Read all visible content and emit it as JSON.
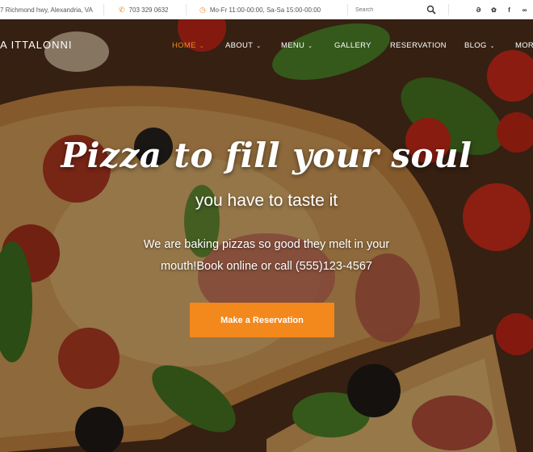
{
  "topbar": {
    "address": "7 Richmond hwy, Alexandria, VA",
    "phone": "703 329 0632",
    "hours": "Mo-Fr 11:00-00:00, Sa-Sa 15:00-00:00",
    "search_placeholder": "Search",
    "social": [
      "foursquare-icon",
      "twitter-icon",
      "facebook-icon",
      "tripadvisor-icon"
    ]
  },
  "brand": {
    "logo_text": "A ITTALONNI"
  },
  "nav": {
    "items": [
      {
        "label": "HOME",
        "active": true,
        "dropdown": true
      },
      {
        "label": "ABOUT",
        "active": false,
        "dropdown": true
      },
      {
        "label": "MENU",
        "active": false,
        "dropdown": true
      },
      {
        "label": "GALLERY",
        "active": false,
        "dropdown": false
      },
      {
        "label": "RESERVATION",
        "active": false,
        "dropdown": false
      },
      {
        "label": "BLOG",
        "active": false,
        "dropdown": true
      },
      {
        "label": "MOR",
        "active": false,
        "dropdown": false
      }
    ]
  },
  "hero": {
    "title": "Pizza to fill your soul",
    "subtitle": "you have to taste it",
    "description": "We are baking pizzas so good they melt in your mouth!Book online or call (555)123-4567",
    "cta_label": "Make a Reservation"
  },
  "colors": {
    "accent": "#f3881c",
    "topbar_bg": "#ffffff"
  }
}
